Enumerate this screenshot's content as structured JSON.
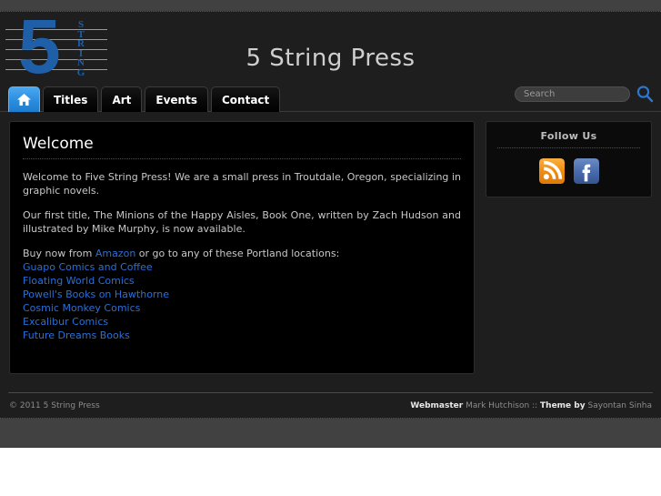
{
  "site": {
    "title": "5 String Press",
    "logo": {
      "numeral": "5",
      "word_letters": [
        "S",
        "T",
        "R",
        "I",
        "N",
        "G"
      ],
      "accent_color": "#1f5fa8"
    }
  },
  "nav": {
    "items": [
      {
        "label": "",
        "icon": "home-icon",
        "name": "home",
        "active": true
      },
      {
        "label": "Titles",
        "icon": "",
        "name": "titles",
        "active": false
      },
      {
        "label": "Art",
        "icon": "",
        "name": "art",
        "active": false
      },
      {
        "label": "Events",
        "icon": "",
        "name": "events",
        "active": false
      },
      {
        "label": "Contact",
        "icon": "",
        "name": "contact",
        "active": false
      }
    ],
    "active_color": "#2b8ddf"
  },
  "search": {
    "value": "",
    "placeholder": "Search",
    "icon": "search-icon",
    "icon_color": "#2b78d4"
  },
  "content": {
    "title": "Welcome",
    "paragraph1": "Welcome to Five String Press! We are a small press in Troutdale, Oregon, specializing in graphic novels.",
    "paragraph2": "Our first title, The Minions of the Happy Aisles, Book One, written by Zach Hudson and illustrated by Mike Murphy, is now available.",
    "buy_prefix": "Buy now from ",
    "buy_link": "Amazon",
    "buy_suffix": " or go to any of these Portland locations:",
    "stores": [
      "Guapo Comics and Coffee",
      "Floating World Comics",
      "Powell's Books on Hawthorne",
      "Cosmic Monkey Comics",
      "Excalibur Comics",
      "Future Dreams Books"
    ],
    "link_color": "#2b6fd6"
  },
  "sidebar": {
    "widget_title": "Follow Us",
    "social": [
      {
        "name": "rss-icon",
        "label": "RSS",
        "color": "#f0910c"
      },
      {
        "name": "facebook-icon",
        "label": "Facebook",
        "color": "#3b5a9b"
      }
    ]
  },
  "footer": {
    "copyright_symbol": "©",
    "copyright_year": "2011",
    "copyright_name": "5 String Press",
    "webmaster_label": "Webmaster",
    "webmaster_name": "Mark Hutchison",
    "separator": "::",
    "theme_label": "Theme by",
    "theme_author": "Sayontan Sinha"
  }
}
